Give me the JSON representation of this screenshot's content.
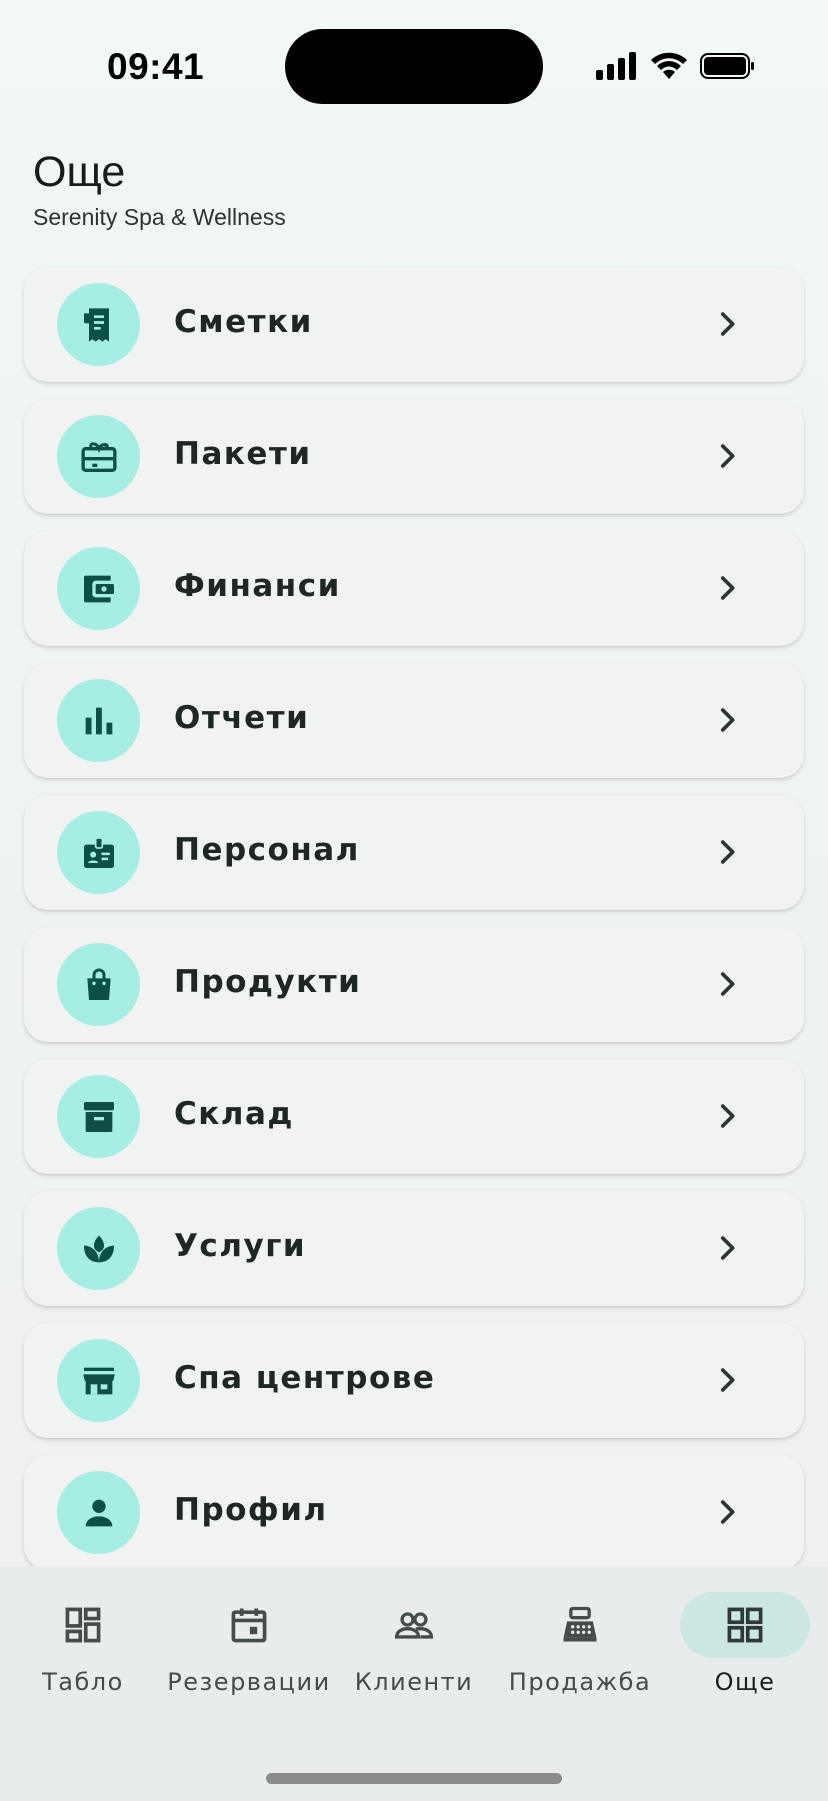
{
  "status_bar": {
    "time": "09:41"
  },
  "header": {
    "title": "Още",
    "subtitle": "Serenity Spa & Wellness"
  },
  "menu": {
    "items": [
      {
        "label": "Сметки",
        "icon": "receipt-icon"
      },
      {
        "label": "Пакети",
        "icon": "gift-card-icon"
      },
      {
        "label": "Финанси",
        "icon": "wallet-icon"
      },
      {
        "label": "Отчети",
        "icon": "bar-chart-icon"
      },
      {
        "label": "Персонал",
        "icon": "badge-icon"
      },
      {
        "label": "Продукти",
        "icon": "shopping-bag-icon"
      },
      {
        "label": "Склад",
        "icon": "archive-box-icon"
      },
      {
        "label": "Услуги",
        "icon": "spa-lotus-icon"
      },
      {
        "label": "Спа центрове",
        "icon": "storefront-icon"
      },
      {
        "label": "Профил",
        "icon": "person-icon"
      }
    ]
  },
  "bottom_nav": {
    "items": [
      {
        "label": "Табло",
        "icon": "dashboard-icon",
        "active": false
      },
      {
        "label": "Резервации",
        "icon": "calendar-icon",
        "active": false
      },
      {
        "label": "Клиенти",
        "icon": "people-icon",
        "active": false
      },
      {
        "label": "Продажба",
        "icon": "cash-register-icon",
        "active": false
      },
      {
        "label": "Още",
        "icon": "grid-icon",
        "active": true
      }
    ]
  },
  "colors": {
    "icon_circle": "#a6ede3",
    "icon_fg": "#0d4f47",
    "active_pill": "#cbe7e4",
    "card_bg": "#f1f3f2"
  }
}
